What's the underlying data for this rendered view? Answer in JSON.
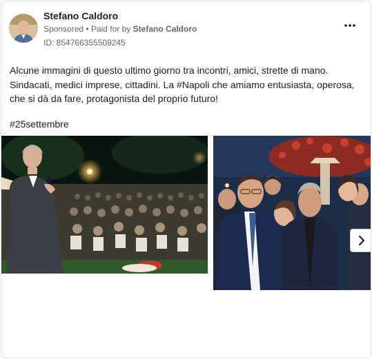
{
  "post": {
    "author": "Stefano Caldoro",
    "sponsored": "Sponsored",
    "separator": "•",
    "paid_for_label": "Paid for by",
    "payer": "Stefano Caldoro",
    "id_text": "ID: 854766355509245",
    "text": "Alcune immagini di questo ultimo giorno tra incontri, amici, strette di mano. Sindacati, medici imprese, cittadini. La #Napoli che amiamo entusiasta, operosa, che si dà da fare, protagonista del proprio futuro!",
    "hashtag": "#25settembre"
  },
  "icons": {
    "more": "more-horizontal-icon",
    "next": "chevron-right-icon"
  },
  "colors": {
    "text_primary": "#1c1e21",
    "text_secondary": "#65676b",
    "border": "#dddfe2"
  }
}
